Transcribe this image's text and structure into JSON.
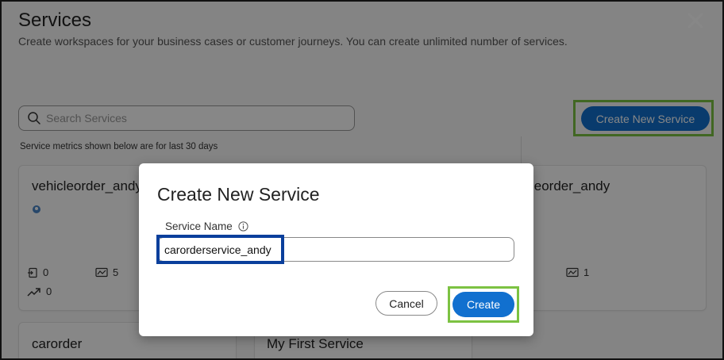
{
  "page": {
    "title": "Services",
    "subtitle": "Create workspaces for your business cases or customer journeys. You can create unlimited number of services."
  },
  "search": {
    "placeholder": "Search Services"
  },
  "metrics_note": "Service metrics shown below are for last 30 days",
  "create_new_label": "Create New Service",
  "cards": [
    {
      "title": "vehicleorder_andy",
      "metric_a": "0",
      "metric_b": "5",
      "metric_c": "0"
    },
    {
      "title": "leorder_andy",
      "metric_b": "1"
    },
    {
      "title": "carorder"
    },
    {
      "title": "My First Service"
    }
  ],
  "modal": {
    "title": "Create New Service",
    "field_label": "Service Name",
    "field_value": "carorderservice_andy",
    "cancel_label": "Cancel",
    "create_label": "Create"
  },
  "colors": {
    "accent": "#1170cf",
    "highlight_green": "#7cc242",
    "highlight_blue": "#0a3f9c"
  }
}
